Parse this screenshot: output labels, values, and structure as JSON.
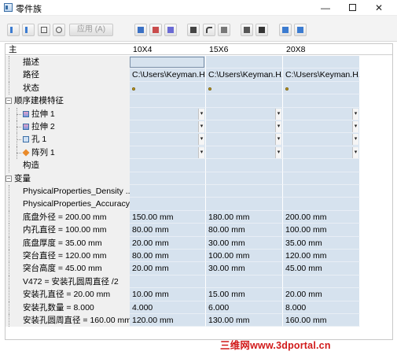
{
  "window": {
    "title": "零件族",
    "minimize_glyph": "—",
    "close_glyph": "✕"
  },
  "toolbar": {
    "apply_label": "应用 (A)",
    "buttons_left": [
      "insert-row-icon",
      "delete-row-icon",
      "copy-icon",
      "search-icon"
    ],
    "buttons_right": [
      "table-icon",
      "edit-table-icon",
      "import-icon",
      "save-icon",
      "undo-icon",
      "print-icon",
      "move-icon",
      "stamp-icon",
      "export-icon",
      "settings-icon"
    ]
  },
  "columns": {
    "main": "主",
    "c1": "10X4",
    "c2": "15X6",
    "c3": "20X8"
  },
  "rows": [
    {
      "label": "描述",
      "indent": 1,
      "values": [
        "",
        "",
        ""
      ],
      "type": "desc"
    },
    {
      "label": "路径",
      "indent": 1,
      "values": [
        "C:\\Users\\Keyman.H...",
        "C:\\Users\\Keyman.H...",
        "C:\\Users\\Keyman.H..."
      ],
      "type": "text"
    },
    {
      "label": "状态",
      "indent": 1,
      "values": [
        "",
        "",
        ""
      ],
      "type": "status"
    },
    {
      "label": "顺序建模特征",
      "indent": 0,
      "values": [
        "",
        "",
        ""
      ],
      "type": "group"
    },
    {
      "label": "拉伸 1",
      "indent": 2,
      "values": [
        "",
        "",
        ""
      ],
      "type": "feature",
      "icon": "extrude-icon"
    },
    {
      "label": "拉伸 2",
      "indent": 2,
      "values": [
        "",
        "",
        ""
      ],
      "type": "feature",
      "icon": "extrude-icon"
    },
    {
      "label": "孔 1",
      "indent": 2,
      "values": [
        "",
        "",
        ""
      ],
      "type": "feature",
      "icon": "hole-icon"
    },
    {
      "label": "阵列 1",
      "indent": 2,
      "values": [
        "",
        "",
        ""
      ],
      "type": "feature",
      "icon": "pattern-icon"
    },
    {
      "label": "构造",
      "indent": 1,
      "values": [
        "",
        "",
        ""
      ],
      "type": "plain"
    },
    {
      "label": "变量",
      "indent": 0,
      "values": [
        "",
        "",
        ""
      ],
      "type": "group"
    },
    {
      "label": "PhysicalProperties_Density ...",
      "indent": 1,
      "values": [
        "",
        "",
        ""
      ],
      "type": "var"
    },
    {
      "label": "PhysicalProperties_Accuracy...",
      "indent": 1,
      "values": [
        "",
        "",
        ""
      ],
      "type": "var"
    },
    {
      "label": "底盘外径 = 200.00 mm",
      "indent": 1,
      "values": [
        "150.00 mm",
        "180.00 mm",
        "200.00 mm"
      ],
      "type": "var"
    },
    {
      "label": "内孔直径 = 100.00 mm",
      "indent": 1,
      "values": [
        "80.00 mm",
        "80.00 mm",
        "100.00 mm"
      ],
      "type": "var"
    },
    {
      "label": "底盘厚度 = 35.00 mm",
      "indent": 1,
      "values": [
        "20.00 mm",
        "30.00 mm",
        "35.00 mm"
      ],
      "type": "var"
    },
    {
      "label": "突台直径 = 120.00 mm",
      "indent": 1,
      "values": [
        "80.00 mm",
        "100.00 mm",
        "120.00 mm"
      ],
      "type": "var"
    },
    {
      "label": "突台高度 = 45.00 mm",
      "indent": 1,
      "values": [
        "20.00 mm",
        "30.00 mm",
        "45.00 mm"
      ],
      "type": "var"
    },
    {
      "label": "V472 = 安装孔圆周直径 /2",
      "indent": 1,
      "values": [
        "",
        "",
        ""
      ],
      "type": "var"
    },
    {
      "label": "安装孔直径 = 20.00 mm",
      "indent": 1,
      "values": [
        "10.00 mm",
        "15.00 mm",
        "20.00 mm"
      ],
      "type": "var"
    },
    {
      "label": "安装孔数量 = 8.000",
      "indent": 1,
      "values": [
        "4.000",
        "6.000",
        "8.000"
      ],
      "type": "var"
    },
    {
      "label": "安装孔圆周直径 = 160.00 mm",
      "indent": 1,
      "values": [
        "120.00 mm",
        "130.00 mm",
        "160.00 mm"
      ],
      "type": "var"
    }
  ],
  "watermark": "三维网www.3dportal.cn"
}
